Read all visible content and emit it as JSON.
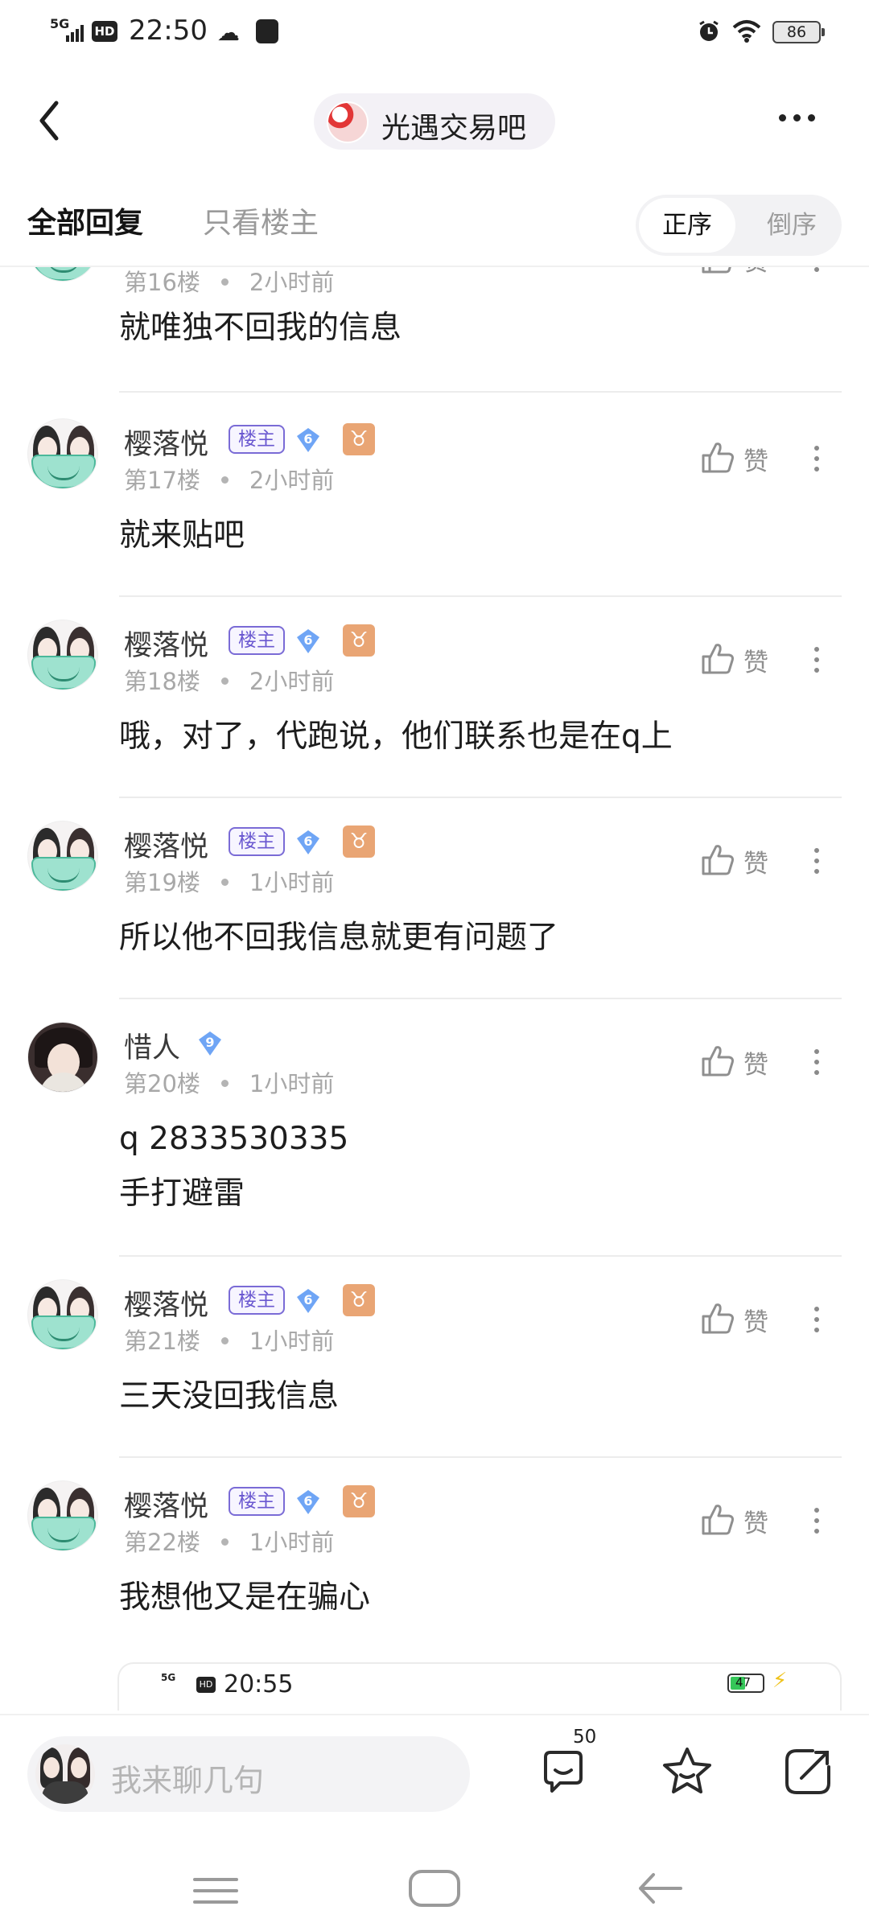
{
  "status_bar": {
    "network": "5G",
    "hd": "HD",
    "time": "22:50",
    "battery": "86"
  },
  "header": {
    "forum_name": "光遇交易吧"
  },
  "tabs": {
    "all_replies": "全部回复",
    "op_only": "只看楼主",
    "sort_asc": "正序",
    "sort_desc": "倒序"
  },
  "badges": {
    "op": "楼主",
    "zodiac": "♉"
  },
  "like_label": "赞",
  "posts": [
    {
      "floor": "第16楼",
      "time": "2小时前",
      "content": [
        "就唯独不回我的信息"
      ]
    },
    {
      "author": "樱落悦",
      "is_op": true,
      "level": "6",
      "floor": "第17楼",
      "time": "2小时前",
      "content": [
        "就来贴吧"
      ]
    },
    {
      "author": "樱落悦",
      "is_op": true,
      "level": "6",
      "floor": "第18楼",
      "time": "2小时前",
      "content": [
        "哦，对了，代跑说，他们联系也是在q上"
      ]
    },
    {
      "author": "樱落悦",
      "is_op": true,
      "level": "6",
      "floor": "第19楼",
      "time": "1小时前",
      "content": [
        "所以他不回我信息就更有问题了"
      ]
    },
    {
      "author": "惜人",
      "is_op": false,
      "level": "9",
      "floor": "第20楼",
      "time": "1小时前",
      "content": [
        "q 2833530335",
        "手打避雷"
      ]
    },
    {
      "author": "樱落悦",
      "is_op": true,
      "level": "6",
      "floor": "第21楼",
      "time": "1小时前",
      "content": [
        "三天没回我信息"
      ]
    },
    {
      "author": "樱落悦",
      "is_op": true,
      "level": "6",
      "floor": "第22楼",
      "time": "1小时前",
      "content": [
        "我想他又是在骗心"
      ]
    }
  ],
  "embedded_screenshot": {
    "time": "20:55",
    "network": "5G",
    "hd": "HD",
    "battery": "47"
  },
  "bottom_bar": {
    "input_placeholder": "我来聊几句",
    "comment_count": "50"
  },
  "colors": {
    "accent_purple": "#6a58d0",
    "level_badge_blue": "#6fa5f5",
    "zodiac_orange": "#e9a574",
    "meta_gray": "#a8a8a8"
  },
  "icons": [
    "back-chevron-icon",
    "more-dots-icon",
    "thumbs-up-icon",
    "comment-icon",
    "star-icon",
    "share-icon",
    "alarm-icon",
    "wifi-icon",
    "battery-icon"
  ]
}
